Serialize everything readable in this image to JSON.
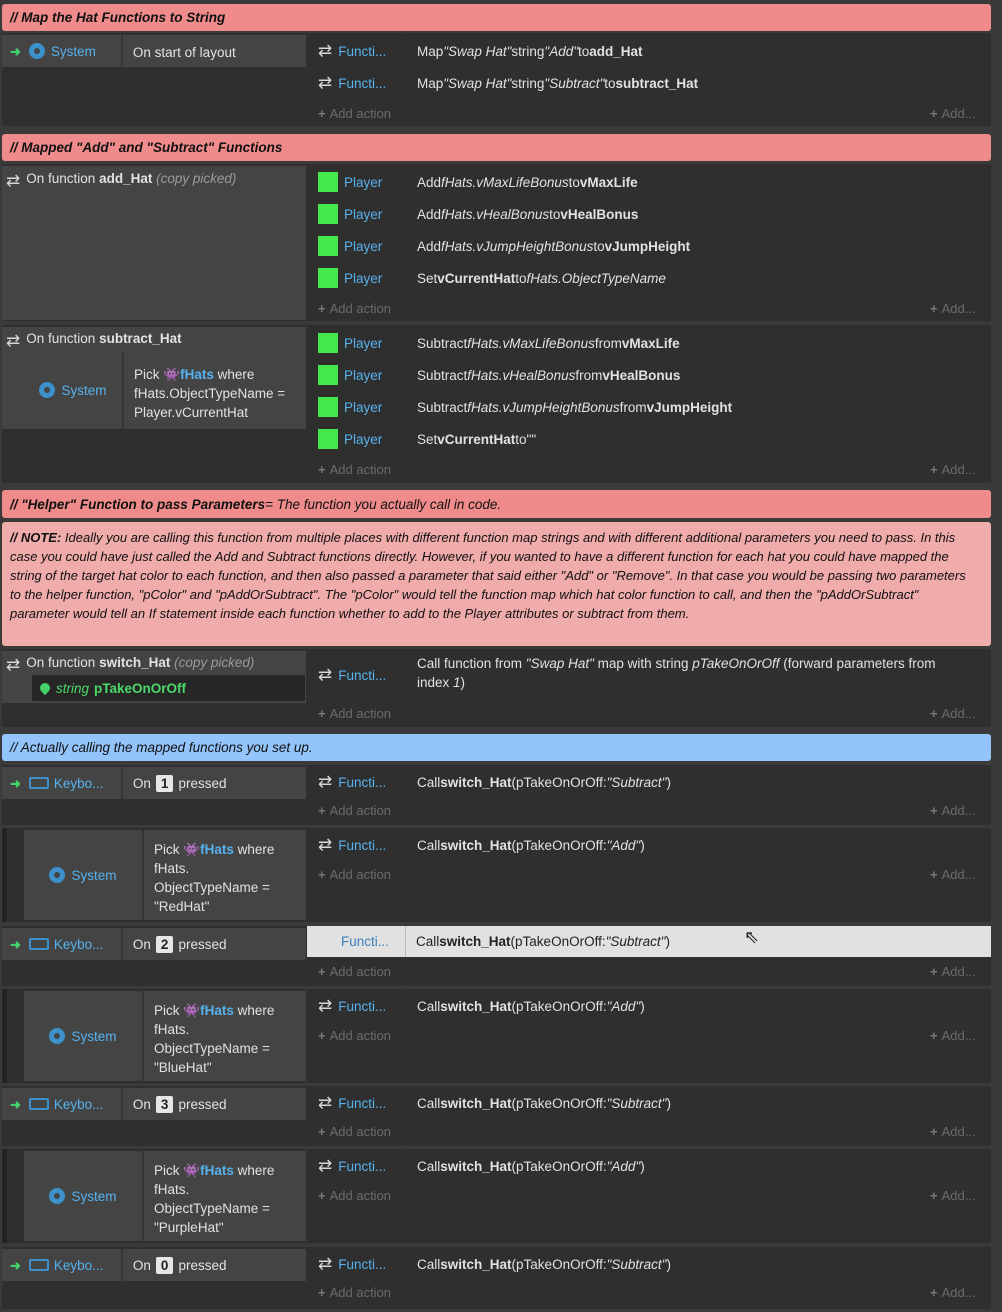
{
  "comments": {
    "c1": "//  Map the Hat Functions to String",
    "c2": "//  Mapped \"Add\" and \"Subtract\" Functions",
    "c3_bold": "//  \"Helper\" Function to pass Parameters",
    "c3_rest": " = The function you actually call in code.",
    "note_lead": "//  NOTE:",
    "note_text": " Ideally you are calling this function from multiple places with different function map strings and with different additional parameters you need to pass. In this case you could have just called the Add and Subtract functions directly. However, if you wanted to have a different function for each hat you could have mapped the string of the target hat color to each function, and then also passed a parameter that said either \"Add\" or \"Remove\". In that case you would be passing two parameters to the helper function, \"pColor\" and \"pAddOrSubtract\". The \"pColor\" would tell the function map which hat color function to call, and then the \"pAddOrSubtract\" parameter would tell an If statement inside each function whether to add to the Player attributes or subtract from them.",
    "c4": "//  Actually calling the mapped functions you set up."
  },
  "labels": {
    "system": "System",
    "functions": "Functi...",
    "player": "Player",
    "keyboard": "Keybo...",
    "add_action": "Add action",
    "add": "Add...",
    "pick": "Pick",
    "fhats": "fHats",
    "where": "where",
    "on": "On",
    "pressed": "pressed",
    "on_function": "On function",
    "copy_picked": "(copy picked)"
  },
  "block1": {
    "condition": "On start of layout",
    "actions": [
      {
        "pre": "Map ",
        "i1": "\"Swap Hat\"",
        "mid": " string ",
        "i2": "\"Add\"",
        "to": " to ",
        "b": "add_Hat"
      },
      {
        "pre": "Map ",
        "i1": "\"Swap Hat\"",
        "mid": " string ",
        "i2": "\"Subtract\"",
        "to": " to ",
        "b": "subtract_Hat"
      }
    ]
  },
  "block2": {
    "fn": "add_Hat",
    "actions": [
      {
        "pre": "Add ",
        "i": "fHats.vMaxLifeBonus",
        "mid": " to ",
        "b": "vMaxLife"
      },
      {
        "pre": "Add ",
        "i": "fHats.vHealBonus",
        "mid": " to ",
        "b": "vHealBonus"
      },
      {
        "pre": "Add ",
        "i": "fHats.vJumpHeightBonus",
        "mid": " to ",
        "b": "vJumpHeight"
      }
    ],
    "set": {
      "pre": "Set ",
      "b": "vCurrentHat",
      "mid": " to ",
      "i": "fHats.ObjectTypeName"
    }
  },
  "block3": {
    "fn": "subtract_Hat",
    "pick_line2": "fHats.ObjectTypeName =",
    "pick_line3": "Player.vCurrentHat",
    "actions": [
      {
        "pre": "Subtract ",
        "i": "fHats.vMaxLifeBonus",
        "mid": " from ",
        "b": "vMaxLife"
      },
      {
        "pre": "Subtract ",
        "i": "fHats.vHealBonus",
        "mid": " from ",
        "b": "vHealBonus"
      },
      {
        "pre": "Subtract ",
        "i": "fHats.vJumpHeightBonus",
        "mid": " from ",
        "b": "vJumpHeight"
      }
    ],
    "set": {
      "pre": "Set ",
      "b": "vCurrentHat",
      "mid": " to ",
      "rest": "\"\""
    }
  },
  "block4": {
    "fn": "switch_Hat",
    "param_type": "string",
    "param_name": "pTakeOnOrOff",
    "action_pre": "Call function from ",
    "action_i1": "\"Swap Hat\"",
    "action_mid": " map with string ",
    "action_i2": "pTakeOnOrOff",
    "action_post": " (forward parameters from",
    "action_line2_pre": "index ",
    "action_line2_i": "1",
    "action_line2_post": ")"
  },
  "calls": {
    "pre": "Call ",
    "fn": "switch_Hat",
    "open": " (pTakeOnOrOff: ",
    "subtract": "\"Subtract\"",
    "add": "\"Add\"",
    "close": ")",
    "keys": [
      "1",
      "2",
      "3",
      "0"
    ],
    "sub_line2": "fHats.",
    "sub_line3": "ObjectTypeName =",
    "hats": [
      "\"RedHat\"",
      "\"BlueHat\"",
      "\"PurpleHat\""
    ]
  }
}
